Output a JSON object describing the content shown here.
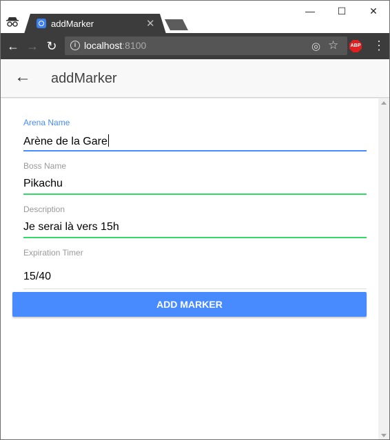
{
  "browser": {
    "tab_title": "addMarker",
    "url_host": "localhost",
    "url_port": ":8100",
    "abp_label": "ABP"
  },
  "app": {
    "title": "addMarker"
  },
  "form": {
    "fields": [
      {
        "label": "Arena Name",
        "value": "Arène de la Gare",
        "state": "focused",
        "label_color": "#488aff",
        "line_color": "#488aff"
      },
      {
        "label": "Boss Name",
        "value": "Pikachu",
        "state": "valid",
        "label_color": "#999999",
        "line_color": "#32db64"
      },
      {
        "label": "Description",
        "value": "Je serai là vers 15h",
        "state": "valid",
        "label_color": "#999999",
        "line_color": "#32db64"
      },
      {
        "label": "Expiration Timer",
        "value": "15/40",
        "state": "default",
        "label_color": "#999999",
        "line_color": "#dedede"
      }
    ],
    "submit_label": "ADD MARKER"
  },
  "colors": {
    "primary": "#488aff",
    "valid": "#32db64",
    "browser_dark": "#3c3c3c"
  }
}
